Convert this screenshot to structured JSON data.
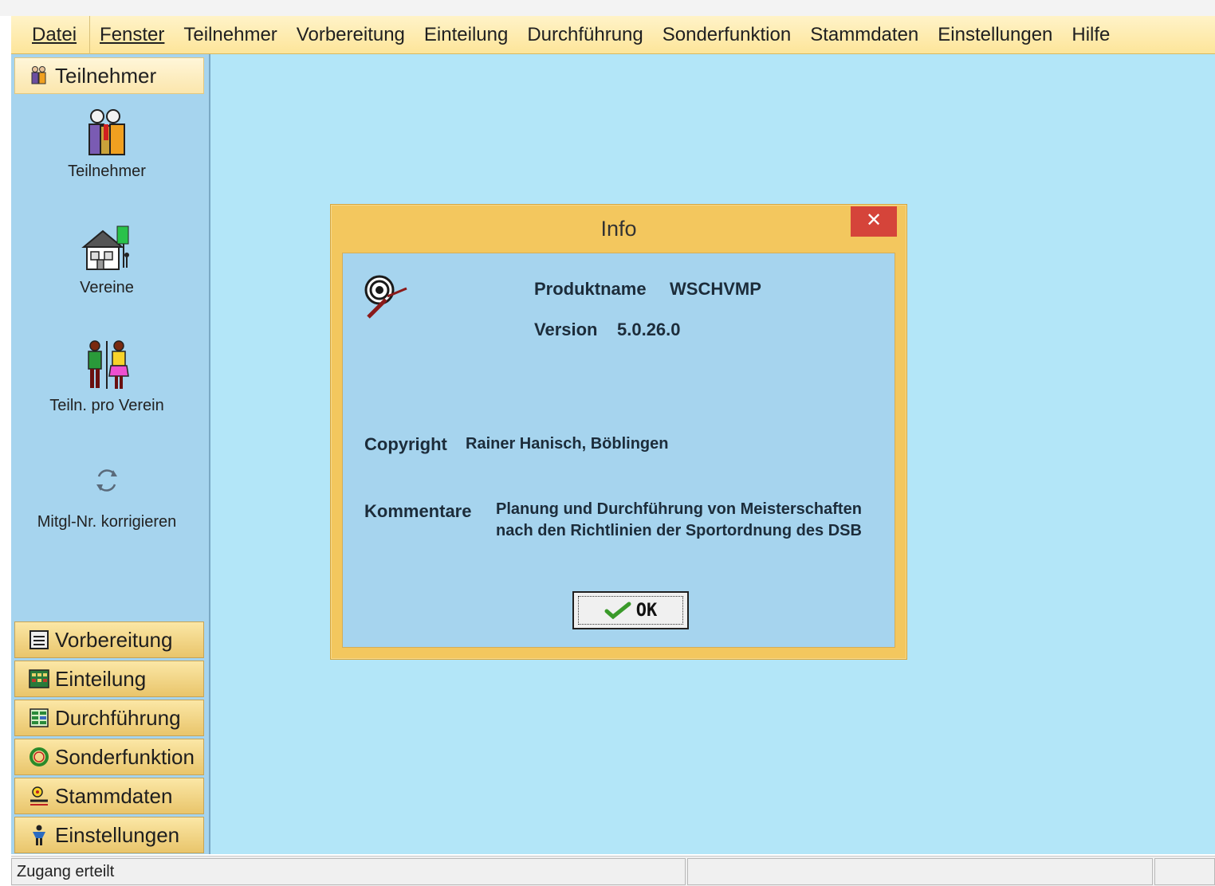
{
  "menu": {
    "items": [
      "Datei",
      "Fenster",
      "Teilnehmer",
      "Vorbereitung",
      "Einteilung",
      "Durchführung",
      "Sonderfunktion",
      "Stammdaten",
      "Einstellungen",
      "Hilfe"
    ]
  },
  "sidebar": {
    "header": "Teilnehmer",
    "items": [
      {
        "label": "Teilnehmer",
        "icon": "participants-icon"
      },
      {
        "label": "Vereine",
        "icon": "clubhouse-icon"
      },
      {
        "label": "Teiln. pro Verein",
        "icon": "couple-icon"
      },
      {
        "label": "Mitgl-Nr. korrigieren",
        "icon": "refresh-icon"
      }
    ],
    "groups": [
      "Vorbereitung",
      "Einteilung",
      "Durchführung",
      "Sonderfunktion",
      "Stammdaten",
      "Einstellungen"
    ]
  },
  "dialog": {
    "title": "Info",
    "close_symbol": "✕",
    "product_label": "Produktname",
    "product_value": "WSCHVMP",
    "version_label": "Version",
    "version_value": "5.0.26.0",
    "copyright_label": "Copyright",
    "copyright_value": "Rainer Hanisch, Böblingen",
    "comments_label": "Kommentare",
    "comments_value": "Planung und Durchführung von Meisterschaften nach den Richtlinien der Sportordnung des DSB",
    "ok_label": "OK"
  },
  "status": {
    "text": "Zugang erteilt"
  },
  "colors": {
    "main_bg": "#b3e6f8",
    "sidebar_bg": "#a6d4ee",
    "menubar_bg": "#fde59a",
    "dialog_frame": "#f3c75e",
    "close_button": "#d5443a"
  }
}
